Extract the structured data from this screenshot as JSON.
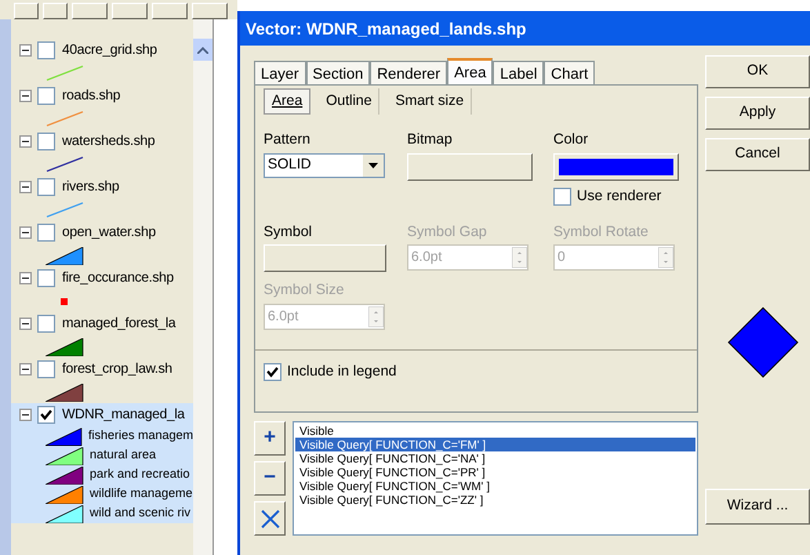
{
  "legend": {
    "layers": [
      {
        "name": "40acre_grid.shp",
        "checked": false,
        "kind": "line",
        "color": "#80e040"
      },
      {
        "name": "roads.shp",
        "checked": false,
        "kind": "line",
        "color": "#f09040"
      },
      {
        "name": "watersheds.shp",
        "checked": false,
        "kind": "line",
        "color": "#3030a0"
      },
      {
        "name": "rivers.shp",
        "checked": false,
        "kind": "line",
        "color": "#40a0f0"
      },
      {
        "name": "open_water.shp",
        "checked": false,
        "kind": "polygon",
        "color": "#1e90ff"
      },
      {
        "name": "fire_occurance.shp",
        "checked": false,
        "kind": "point",
        "color": "#ff0000"
      },
      {
        "name": "managed_forest_la",
        "checked": false,
        "kind": "polygon",
        "color": "#008000"
      },
      {
        "name": "forest_crop_law.sh",
        "checked": false,
        "kind": "polygon",
        "color": "#804040"
      },
      {
        "name": "WDNR_managed_la",
        "checked": true,
        "kind": "classes",
        "selected": true,
        "children": [
          {
            "name": "fisheries managem",
            "color": "#0000ff"
          },
          {
            "name": "natural area",
            "color": "#80ff80"
          },
          {
            "name": "park and recreatio",
            "color": "#800080"
          },
          {
            "name": "wildlife manageme",
            "color": "#ff8000"
          },
          {
            "name": "wild and scenic riv",
            "color": "#80ffff"
          }
        ]
      }
    ]
  },
  "dialog": {
    "title": "Vector: WDNR_managed_lands.shp",
    "tabs": [
      {
        "label": "Layer",
        "selected": false
      },
      {
        "label": "Section",
        "selected": false
      },
      {
        "label": "Renderer",
        "selected": false
      },
      {
        "label": "Area",
        "selected": true
      },
      {
        "label": "Label",
        "selected": false
      },
      {
        "label": "Chart",
        "selected": false
      }
    ],
    "subtabs": [
      {
        "label": "Area",
        "selected": true
      },
      {
        "label": "Outline",
        "selected": false
      },
      {
        "label": "Smart size",
        "selected": false
      }
    ],
    "pattern": {
      "label": "Pattern",
      "value": "SOLID"
    },
    "bitmap": {
      "label": "Bitmap"
    },
    "color": {
      "label": "Color",
      "color": "#0000ff"
    },
    "use_renderer": {
      "label": "Use renderer",
      "checked": false
    },
    "symbol": {
      "label": "Symbol"
    },
    "symbol_gap": {
      "label": "Symbol Gap",
      "value": "6.0pt",
      "disabled": true
    },
    "symbol_rotate": {
      "label": "Symbol Rotate",
      "value": "0",
      "disabled": true
    },
    "symbol_size": {
      "label": "Symbol Size",
      "value": "6.0pt",
      "disabled": true
    },
    "include_in_legend": {
      "label": "Include in legend",
      "checked": true
    },
    "queries": [
      {
        "text": "Visible",
        "selected": false
      },
      {
        "text": "Visible Query[ FUNCTION_C='FM' ]",
        "selected": true
      },
      {
        "text": "Visible Query[ FUNCTION_C='NA' ]",
        "selected": false
      },
      {
        "text": "Visible Query[ FUNCTION_C='PR' ]",
        "selected": false
      },
      {
        "text": "Visible Query[ FUNCTION_C='WM' ]",
        "selected": false
      },
      {
        "text": "Visible Query[ FUNCTION_C='ZZ' ]",
        "selected": false
      }
    ],
    "list_buttons": [
      "+",
      "−"
    ],
    "buttons": [
      "OK",
      "Apply",
      "Cancel"
    ],
    "wizard": "Wizard ..."
  }
}
